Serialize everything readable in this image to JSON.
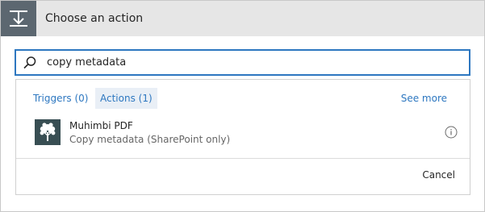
{
  "header": {
    "title": "Choose an action",
    "icon": "action-step-icon",
    "icon_bg_color": "#5c6770"
  },
  "search": {
    "value": "copy metadata",
    "placeholder": "",
    "icon": "search-icon",
    "border_color": "#2d77c0"
  },
  "tabs": [
    {
      "label": "Triggers (0)",
      "selected": false
    },
    {
      "label": "Actions (1)",
      "selected": true
    }
  ],
  "see_more": "See more",
  "results": [
    {
      "title": "Muhimbi PDF",
      "subtitle": "Copy metadata (SharePoint only)",
      "logo": "muhimbi-tree-logo-icon",
      "logo_bg_color": "#384e53",
      "info_icon": "info-icon"
    }
  ],
  "footer": {
    "cancel_label": "Cancel"
  },
  "colors": {
    "accent": "#2d77c0",
    "header_bg": "#e6e6e6"
  }
}
